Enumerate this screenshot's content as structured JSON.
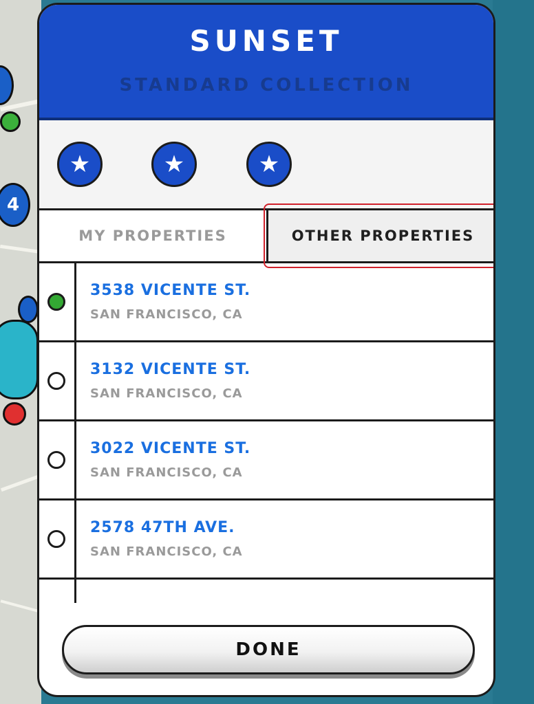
{
  "modal": {
    "title": "SUNSET",
    "subtitle": "STANDARD COLLECTION",
    "done_label": "DONE"
  },
  "stars": {
    "count": 3,
    "glyph": "★",
    "color": "#1a4dc8"
  },
  "tabs": [
    {
      "label": "MY PROPERTIES",
      "active": false
    },
    {
      "label": "OTHER PROPERTIES",
      "active": true
    }
  ],
  "properties": [
    {
      "street": "3538 VICENTE ST.",
      "city": "SAN FRANCISCO, CA",
      "selected": true
    },
    {
      "street": "3132 VICENTE ST.",
      "city": "SAN FRANCISCO, CA",
      "selected": false
    },
    {
      "street": "3022 VICENTE ST.",
      "city": "SAN FRANCISCO, CA",
      "selected": false
    },
    {
      "street": "2578 47TH AVE.",
      "city": "SAN FRANCISCO, CA",
      "selected": false
    }
  ],
  "colors": {
    "header_blue": "#1a4dc8",
    "street_blue": "#1a6fe0",
    "selected_green": "#33a833",
    "highlight_red": "#d0202a"
  }
}
